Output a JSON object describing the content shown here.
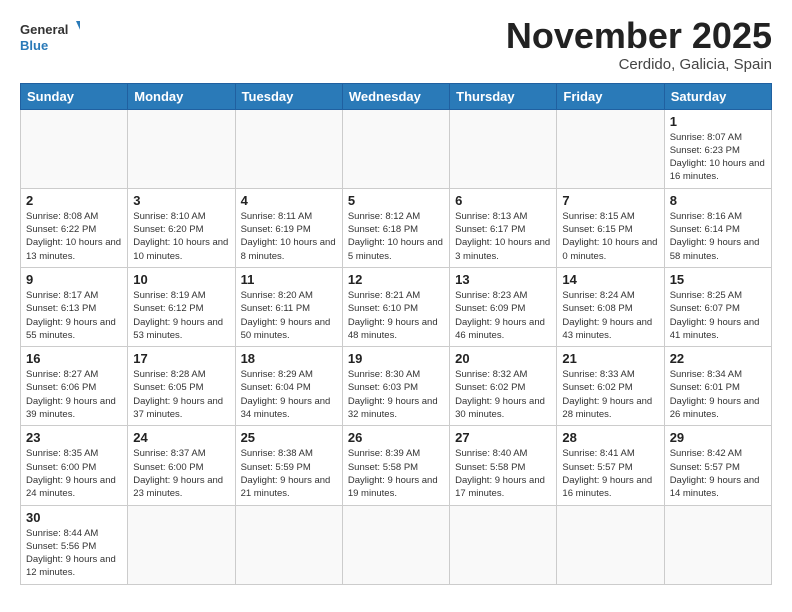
{
  "logo": {
    "general": "General",
    "blue": "Blue"
  },
  "header": {
    "month": "November 2025",
    "location": "Cerdido, Galicia, Spain"
  },
  "weekdays": [
    "Sunday",
    "Monday",
    "Tuesday",
    "Wednesday",
    "Thursday",
    "Friday",
    "Saturday"
  ],
  "weeks": [
    [
      {
        "day": "",
        "info": ""
      },
      {
        "day": "",
        "info": ""
      },
      {
        "day": "",
        "info": ""
      },
      {
        "day": "",
        "info": ""
      },
      {
        "day": "",
        "info": ""
      },
      {
        "day": "",
        "info": ""
      },
      {
        "day": "1",
        "info": "Sunrise: 8:07 AM\nSunset: 6:23 PM\nDaylight: 10 hours and 16 minutes."
      }
    ],
    [
      {
        "day": "2",
        "info": "Sunrise: 8:08 AM\nSunset: 6:22 PM\nDaylight: 10 hours and 13 minutes."
      },
      {
        "day": "3",
        "info": "Sunrise: 8:10 AM\nSunset: 6:20 PM\nDaylight: 10 hours and 10 minutes."
      },
      {
        "day": "4",
        "info": "Sunrise: 8:11 AM\nSunset: 6:19 PM\nDaylight: 10 hours and 8 minutes."
      },
      {
        "day": "5",
        "info": "Sunrise: 8:12 AM\nSunset: 6:18 PM\nDaylight: 10 hours and 5 minutes."
      },
      {
        "day": "6",
        "info": "Sunrise: 8:13 AM\nSunset: 6:17 PM\nDaylight: 10 hours and 3 minutes."
      },
      {
        "day": "7",
        "info": "Sunrise: 8:15 AM\nSunset: 6:15 PM\nDaylight: 10 hours and 0 minutes."
      },
      {
        "day": "8",
        "info": "Sunrise: 8:16 AM\nSunset: 6:14 PM\nDaylight: 9 hours and 58 minutes."
      }
    ],
    [
      {
        "day": "9",
        "info": "Sunrise: 8:17 AM\nSunset: 6:13 PM\nDaylight: 9 hours and 55 minutes."
      },
      {
        "day": "10",
        "info": "Sunrise: 8:19 AM\nSunset: 6:12 PM\nDaylight: 9 hours and 53 minutes."
      },
      {
        "day": "11",
        "info": "Sunrise: 8:20 AM\nSunset: 6:11 PM\nDaylight: 9 hours and 50 minutes."
      },
      {
        "day": "12",
        "info": "Sunrise: 8:21 AM\nSunset: 6:10 PM\nDaylight: 9 hours and 48 minutes."
      },
      {
        "day": "13",
        "info": "Sunrise: 8:23 AM\nSunset: 6:09 PM\nDaylight: 9 hours and 46 minutes."
      },
      {
        "day": "14",
        "info": "Sunrise: 8:24 AM\nSunset: 6:08 PM\nDaylight: 9 hours and 43 minutes."
      },
      {
        "day": "15",
        "info": "Sunrise: 8:25 AM\nSunset: 6:07 PM\nDaylight: 9 hours and 41 minutes."
      }
    ],
    [
      {
        "day": "16",
        "info": "Sunrise: 8:27 AM\nSunset: 6:06 PM\nDaylight: 9 hours and 39 minutes."
      },
      {
        "day": "17",
        "info": "Sunrise: 8:28 AM\nSunset: 6:05 PM\nDaylight: 9 hours and 37 minutes."
      },
      {
        "day": "18",
        "info": "Sunrise: 8:29 AM\nSunset: 6:04 PM\nDaylight: 9 hours and 34 minutes."
      },
      {
        "day": "19",
        "info": "Sunrise: 8:30 AM\nSunset: 6:03 PM\nDaylight: 9 hours and 32 minutes."
      },
      {
        "day": "20",
        "info": "Sunrise: 8:32 AM\nSunset: 6:02 PM\nDaylight: 9 hours and 30 minutes."
      },
      {
        "day": "21",
        "info": "Sunrise: 8:33 AM\nSunset: 6:02 PM\nDaylight: 9 hours and 28 minutes."
      },
      {
        "day": "22",
        "info": "Sunrise: 8:34 AM\nSunset: 6:01 PM\nDaylight: 9 hours and 26 minutes."
      }
    ],
    [
      {
        "day": "23",
        "info": "Sunrise: 8:35 AM\nSunset: 6:00 PM\nDaylight: 9 hours and 24 minutes."
      },
      {
        "day": "24",
        "info": "Sunrise: 8:37 AM\nSunset: 6:00 PM\nDaylight: 9 hours and 23 minutes."
      },
      {
        "day": "25",
        "info": "Sunrise: 8:38 AM\nSunset: 5:59 PM\nDaylight: 9 hours and 21 minutes."
      },
      {
        "day": "26",
        "info": "Sunrise: 8:39 AM\nSunset: 5:58 PM\nDaylight: 9 hours and 19 minutes."
      },
      {
        "day": "27",
        "info": "Sunrise: 8:40 AM\nSunset: 5:58 PM\nDaylight: 9 hours and 17 minutes."
      },
      {
        "day": "28",
        "info": "Sunrise: 8:41 AM\nSunset: 5:57 PM\nDaylight: 9 hours and 16 minutes."
      },
      {
        "day": "29",
        "info": "Sunrise: 8:42 AM\nSunset: 5:57 PM\nDaylight: 9 hours and 14 minutes."
      }
    ],
    [
      {
        "day": "30",
        "info": "Sunrise: 8:44 AM\nSunset: 5:56 PM\nDaylight: 9 hours and 12 minutes."
      },
      {
        "day": "",
        "info": ""
      },
      {
        "day": "",
        "info": ""
      },
      {
        "day": "",
        "info": ""
      },
      {
        "day": "",
        "info": ""
      },
      {
        "day": "",
        "info": ""
      },
      {
        "day": "",
        "info": ""
      }
    ]
  ]
}
